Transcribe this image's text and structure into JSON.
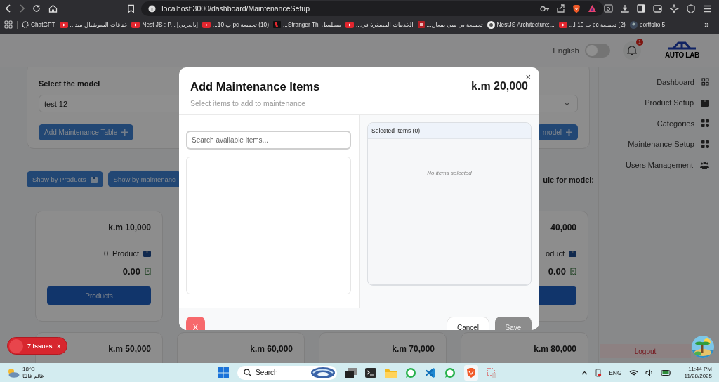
{
  "browser": {
    "url": "localhost:3000/dashboard/MaintenanceSetup",
    "bookmarks": [
      {
        "label": "ChatGPT",
        "kind": "chatgpt"
      },
      {
        "label": "خناقات السوشيال ميد...",
        "kind": "youtube"
      },
      {
        "label": "Nest JS : P... [بالعربي]",
        "kind": "youtube"
      },
      {
        "label": "(10) تجميعة pc ب 10...",
        "kind": "youtube"
      },
      {
        "label": "مسلسل Stranger Thi...",
        "kind": "tile"
      },
      {
        "label": "الخدمات المصغرة في...",
        "kind": "youtube"
      },
      {
        "label": "تجميعة بي سي بمعال...",
        "kind": "square"
      },
      {
        "label": "NestJS Architecture:...",
        "kind": "nest"
      },
      {
        "label": "(2) تجميعة pc ب 10 ا...",
        "kind": "youtube"
      },
      {
        "label": "portfolio 5",
        "kind": "portfolio"
      }
    ],
    "more": "»"
  },
  "header": {
    "language": {
      "label": "English",
      "on": false
    },
    "notifications": {
      "count": "1"
    },
    "logo": "AUTO LAB"
  },
  "sidebar": {
    "items": [
      {
        "label": "Dashboard",
        "kind": "dashboard"
      },
      {
        "label": "Product Setup",
        "kind": "box"
      },
      {
        "label": "Categories",
        "kind": "grid"
      },
      {
        "label": "Maintenance Setup",
        "kind": "grid"
      },
      {
        "label": "Users Management",
        "kind": "users"
      }
    ],
    "logout": "Logout"
  },
  "model_panel": {
    "label": "Select the model",
    "value": "test 12",
    "add_table_button": "Add Maintenance Table",
    "add_model_button": "model"
  },
  "view_buttons": [
    "Show by Products",
    "Show by maintenanc"
  ],
  "schedule_heading": "ule for model:",
  "cards_top": [
    {
      "title": "k.m 10,000",
      "count": "0",
      "unit": "Product",
      "price": "0.00",
      "button": "Products"
    },
    {
      "title": "40,000",
      "unit": "oduct",
      "price": "0.00"
    }
  ],
  "cards_bottom": [
    {
      "title": "k.m 50,000"
    },
    {
      "title": "k.m 60,000"
    },
    {
      "title": "k.m 70,000"
    },
    {
      "title": "k.m 80,000"
    }
  ],
  "modal": {
    "title": "Add Maintenance Items",
    "subtitle": "Select items to add to maintenance",
    "mileage": "k.m 20,000",
    "close": "×",
    "search": {
      "placeholder": "Search available items..."
    },
    "selected": {
      "title": "Selected Items (0)",
      "empty": "No items selected"
    },
    "clear_button": "X",
    "cancel_button": "Cancel",
    "save_button": {
      "label": "Save",
      "disabled": true
    }
  },
  "dev_indicator": {
    "dot": ".",
    "issues": "7 Issues",
    "close": "×"
  },
  "taskbar": {
    "weather": {
      "temp": "18°C",
      "condition": "غائم غالبًا"
    },
    "search": {
      "placeholder": "Search"
    },
    "language": "ENG",
    "time": "11:44 PM",
    "date": "11/28/2025"
  }
}
